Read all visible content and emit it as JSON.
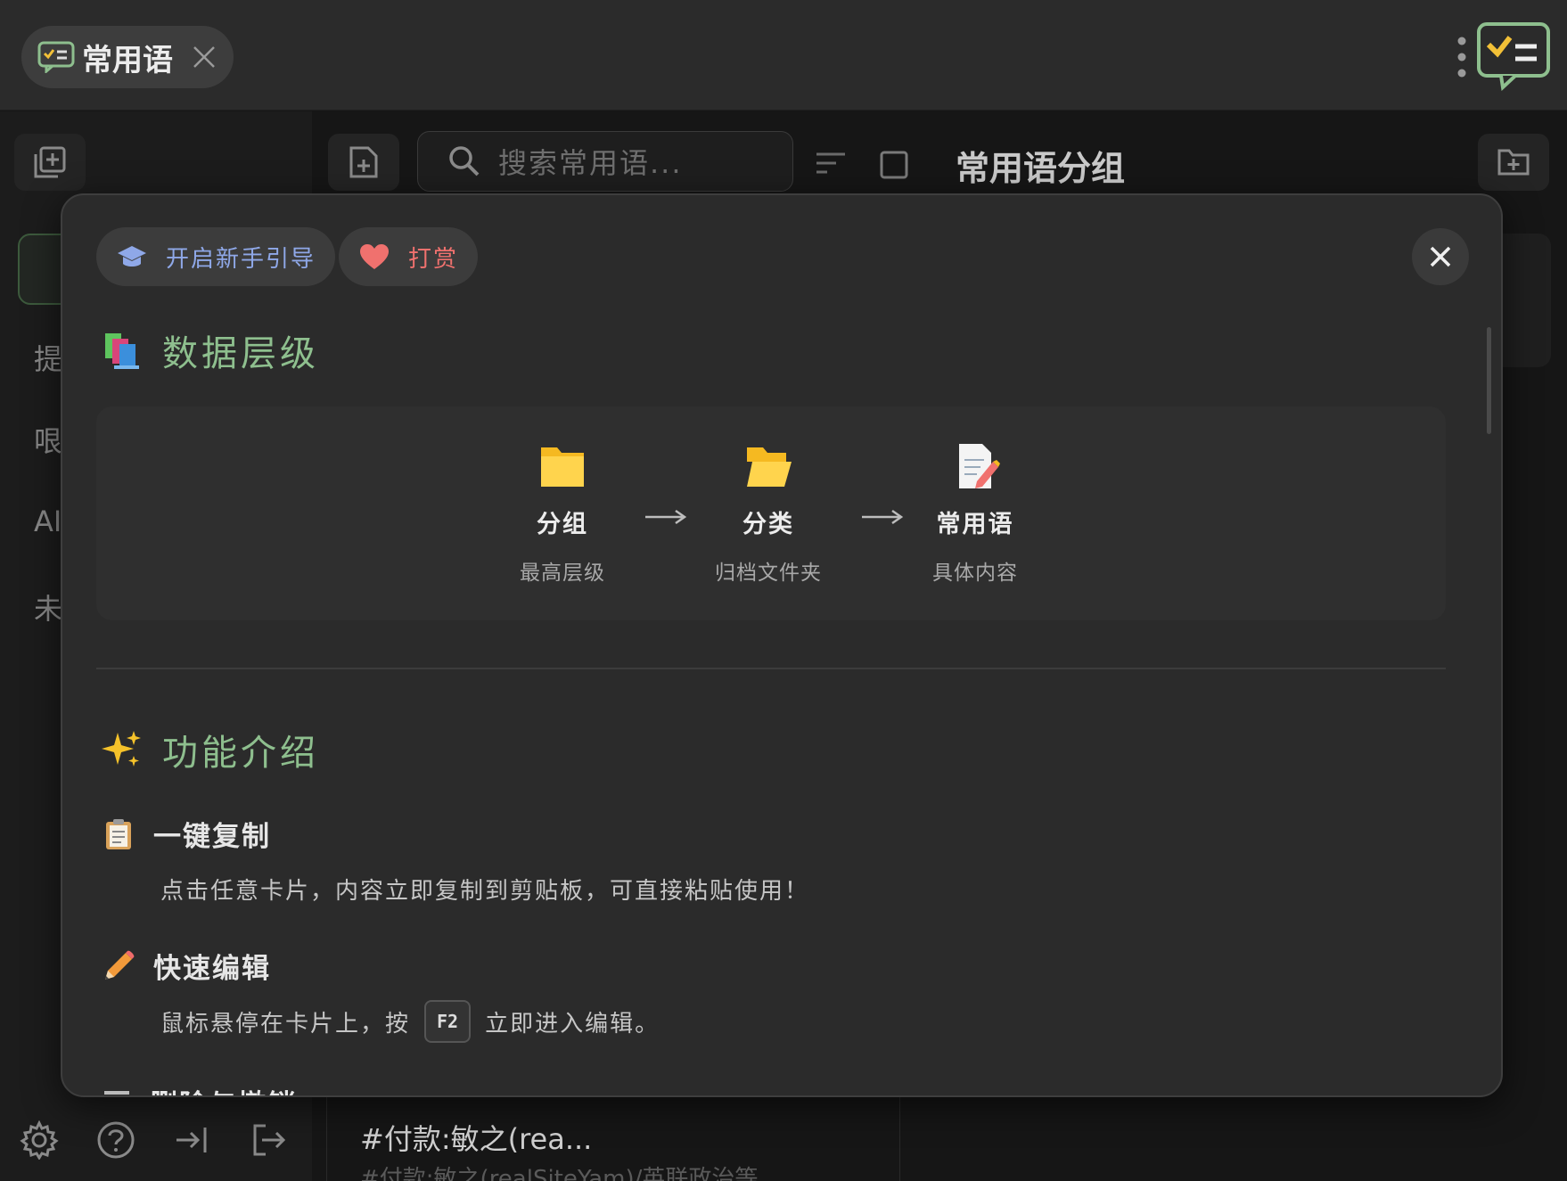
{
  "tab": {
    "label": "常用语"
  },
  "background": {
    "search_placeholder": "搜索常用语...",
    "title": "常用语分组",
    "side_items": [
      "提",
      "哏",
      "AI",
      "未"
    ],
    "snippet": "#付款:敏之(rea...",
    "snippet_faded": "#付款:敏之(realSiteYam)/英联政治等"
  },
  "modal": {
    "guide_label": "开启新手引导",
    "reward_label": "打赏",
    "hierarchy": {
      "title": "数据层级",
      "nodes": [
        {
          "label": "分组",
          "sub": "最高层级",
          "icon": "folder-closed-icon"
        },
        {
          "label": "分类",
          "sub": "归档文件夹",
          "icon": "folder-open-icon"
        },
        {
          "label": "常用语",
          "sub": "具体内容",
          "icon": "memo-icon"
        }
      ]
    },
    "features": {
      "title": "功能介绍",
      "items": [
        {
          "title": "一键复制",
          "desc": "点击任意卡片，内容立即复制到剪贴板，可直接粘贴使用！"
        },
        {
          "title": "快速编辑",
          "desc_before": "鼠标悬停在卡片上，按",
          "key": "F2",
          "desc_after": "立即进入编辑。"
        },
        {
          "title": "删除与撤销"
        }
      ]
    }
  },
  "colors": {
    "accent_green": "#8ebf8e",
    "guide_blue": "#8fa8e8",
    "reward_red": "#f0716e"
  }
}
